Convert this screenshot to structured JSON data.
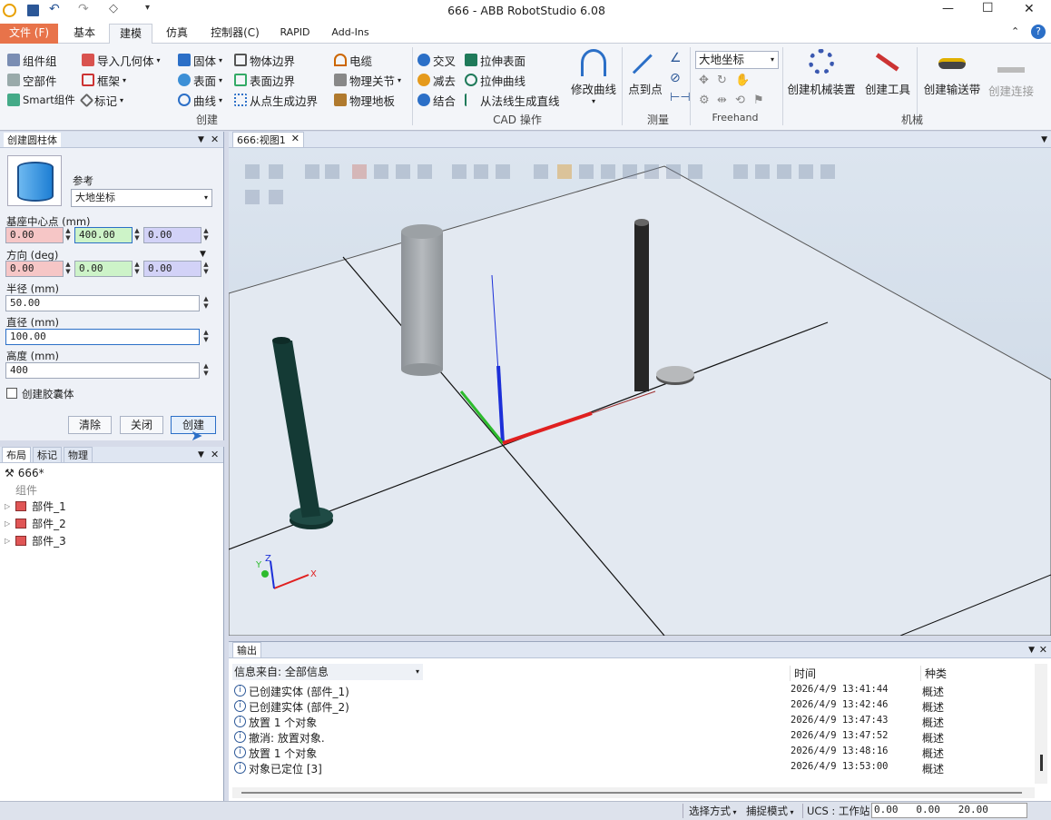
{
  "window": {
    "title": "666 - ABB RobotStudio 6.08",
    "minimize": "—",
    "maximize": "☐",
    "close": "✕"
  },
  "tabs": {
    "file": "文件 (F)",
    "basic": "基本",
    "modeling": "建模",
    "simulation": "仿真",
    "controller": "控制器(C)",
    "rapid": "RAPID",
    "addins": "Add-Ins"
  },
  "ribbon": {
    "create": {
      "component_group": "组件组",
      "empty_part": "空部件",
      "smart_component": "Smart组件",
      "import_geometry": "导入几何体",
      "frame": "框架",
      "marker": "标记",
      "solid": "固体",
      "surface": "表面",
      "curve": "曲线",
      "body_boundary": "物体边界",
      "surface_boundary": "表面边界",
      "boundary_from_points": "从点生成边界",
      "cable": "电缆",
      "physics_joint": "物理关节",
      "physics_floor": "物理地板",
      "label": "创建"
    },
    "cad": {
      "intersect": "交叉",
      "subtract": "减去",
      "union": "结合",
      "extrude_surface": "拉伸表面",
      "extrude_curve": "拉伸曲线",
      "line_from_normal": "从法线生成直线",
      "modify_curve": "修改曲线",
      "label": "CAD 操作"
    },
    "measure": {
      "point_to_point": "点到点",
      "label": "测量"
    },
    "freehand": {
      "coord": "大地坐标",
      "label": "Freehand"
    },
    "mechanism": {
      "create_mechanism": "创建机械装置",
      "create_tool": "创建工具",
      "create_conveyor": "创建输送带",
      "create_connection": "创建连接",
      "label": "机械"
    }
  },
  "cylinder_panel": {
    "title": "创建圆柱体",
    "reference_label": "参考",
    "reference_value": "大地坐标",
    "base_center_label": "基座中心点 (mm)",
    "base_x": "0.00",
    "base_y": "400.00",
    "base_z": "0.00",
    "orientation_label": "方向 (deg)",
    "ori_x": "0.00",
    "ori_y": "0.00",
    "ori_z": "0.00",
    "radius_label": "半径 (mm)",
    "radius": "50.00",
    "diameter_label": "直径 (mm)",
    "diameter": "100.00",
    "height_label": "高度 (mm)",
    "height": "400",
    "capsule_label": "创建胶囊体",
    "clear": "清除",
    "close": "关闭",
    "create": "创建"
  },
  "layout_panel": {
    "tabs": [
      "布局",
      "标记",
      "物理"
    ],
    "station": "666*",
    "components_label": "组件",
    "parts": [
      "部件_1",
      "部件_2",
      "部件_3"
    ]
  },
  "view": {
    "tab": "666:视图1"
  },
  "output": {
    "tab": "输出",
    "source_label": "信息来自: 全部信息",
    "col_time": "时间",
    "col_category": "种类",
    "rows": [
      {
        "msg": "已创建实体 (部件_1)",
        "time": "2026/4/9 13:41:44",
        "cat": "概述"
      },
      {
        "msg": "已创建实体 (部件_2)",
        "time": "2026/4/9 13:42:46",
        "cat": "概述"
      },
      {
        "msg": "放置 1 个对象",
        "time": "2026/4/9 13:47:43",
        "cat": "概述"
      },
      {
        "msg": "撤消: 放置对象.",
        "time": "2026/4/9 13:47:52",
        "cat": "概述"
      },
      {
        "msg": "放置 1 个对象",
        "time": "2026/4/9 13:48:16",
        "cat": "概述"
      },
      {
        "msg": "对象已定位 [3]",
        "time": "2026/4/9 13:53:00",
        "cat": "概述"
      }
    ]
  },
  "status": {
    "select_mode": "选择方式",
    "snap_mode": "捕捉模式",
    "ucs": "UCS : 工作站",
    "coords": "0.00   0.00   20.00"
  },
  "colors": {
    "file_tab": "#e8734a",
    "accent": "#2b5797",
    "axis_x": "#e02020",
    "axis_y": "#2dbb2d",
    "axis_z": "#1c2fd8"
  }
}
